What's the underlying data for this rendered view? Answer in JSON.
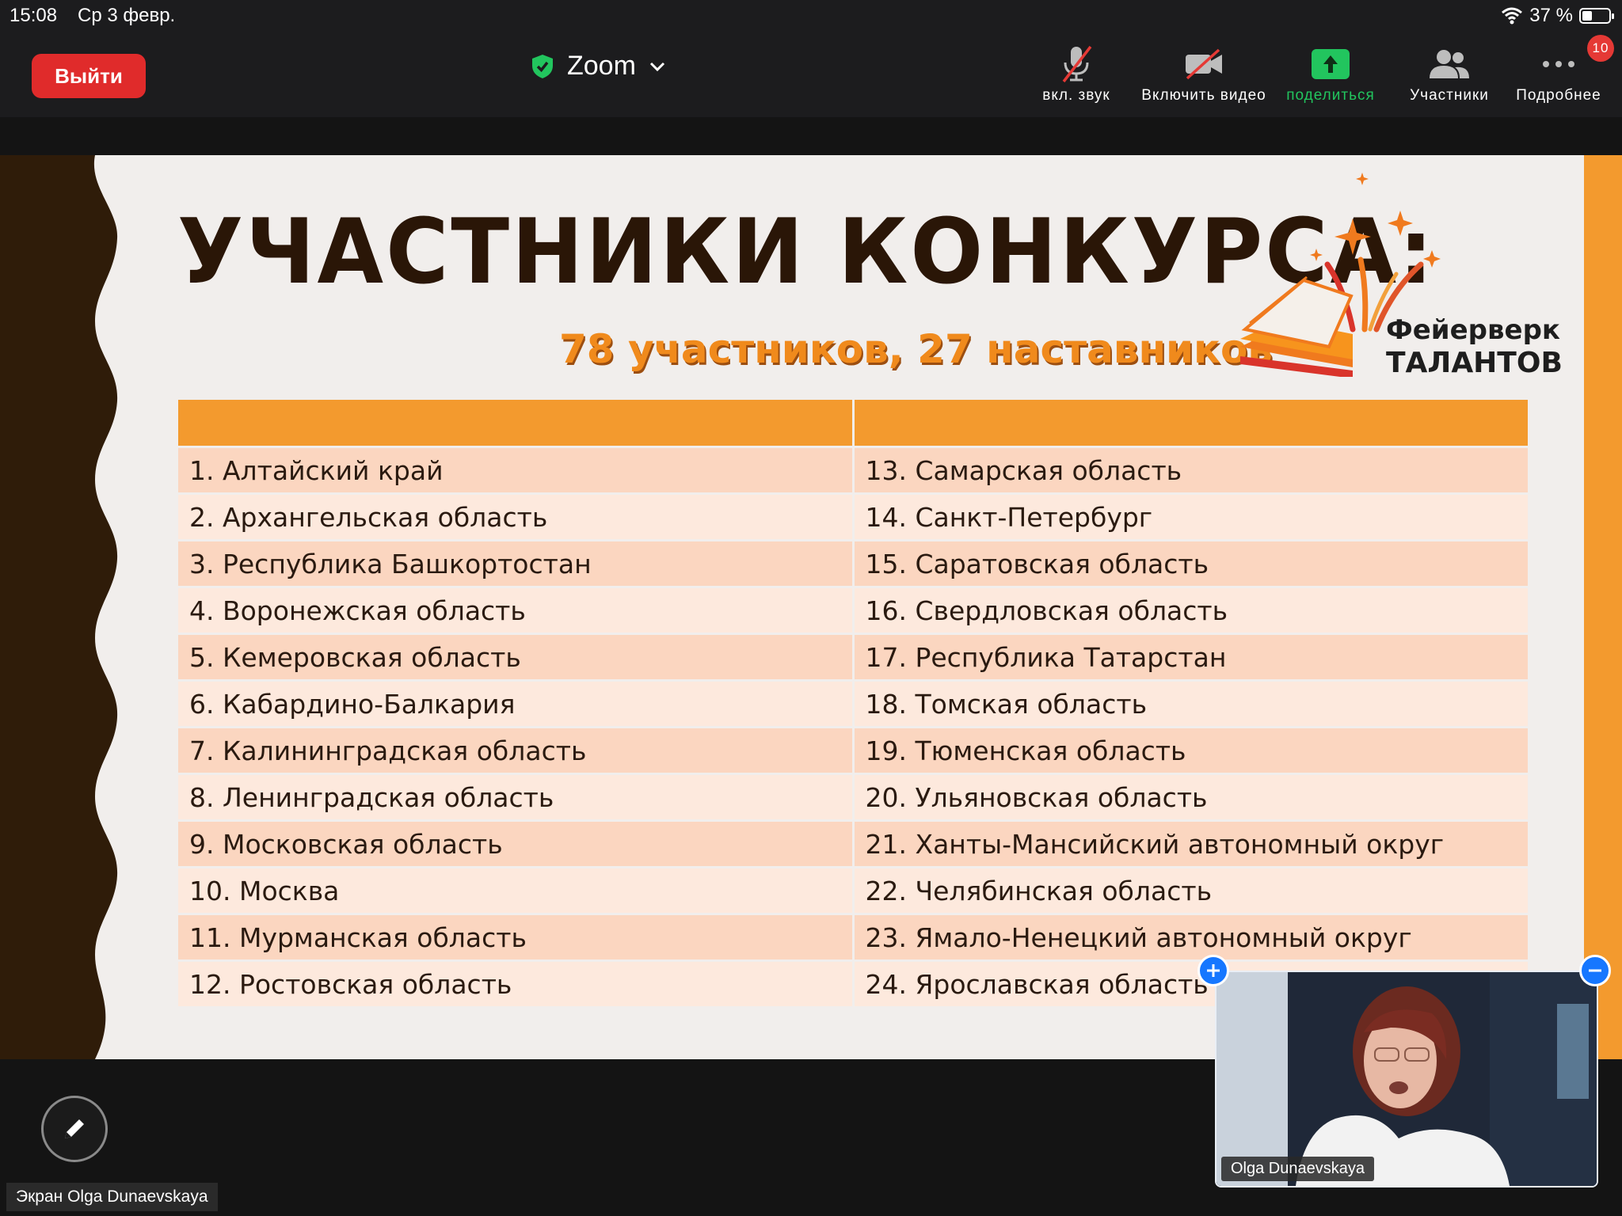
{
  "status_bar": {
    "time": "15:08",
    "date": "Ср 3 февр.",
    "battery": "37 %"
  },
  "toolbar": {
    "leave_label": "Выйти",
    "meeting_name": "Zoom",
    "tools": {
      "audio": "вкл. звук",
      "video": "Включить видео",
      "share": "поделиться",
      "participants": "Участники",
      "more": "Подробнее",
      "more_badge": "10"
    }
  },
  "slide": {
    "title": "УЧАСТНИКИ КОНКУРСА:",
    "subtitle": "78 участников, 27 наставников",
    "logo_text": [
      "Фейерверк",
      "ТАЛАНТОВ"
    ],
    "rows": [
      [
        "1. Алтайский край",
        "13. Самарская область"
      ],
      [
        "2. Архангельская область",
        "14. Санкт-Петербург"
      ],
      [
        "3. Республика Башкортостан",
        "15. Саратовская область"
      ],
      [
        "4. Воронежская область",
        "16. Свердловская область"
      ],
      [
        "5. Кемеровская область",
        "17. Республика Татарстан"
      ],
      [
        "6. Кабардино-Балкария",
        "18. Томская область"
      ],
      [
        "7. Калининградская область",
        "19. Тюменская область"
      ],
      [
        "8. Ленинградская область",
        "20. Ульяновская область"
      ],
      [
        "9. Московская область",
        "21. Ханты-Мансийский автономный округ"
      ],
      [
        "10. Москва",
        "22. Челябинская область"
      ],
      [
        "11. Мурманская область",
        "23. Ямало-Ненецкий автономный округ"
      ],
      [
        "12. Ростовская область",
        "24. Ярославская область"
      ]
    ]
  },
  "video_tile": {
    "name": "Olga Dunaevskaya"
  },
  "screen_label": "Экран Olga Dunaevskaya",
  "colors": {
    "accent_orange": "#f39a2e",
    "leave_red": "#e02b2b",
    "share_green": "#22c55e",
    "title_brown": "#2a1607"
  }
}
